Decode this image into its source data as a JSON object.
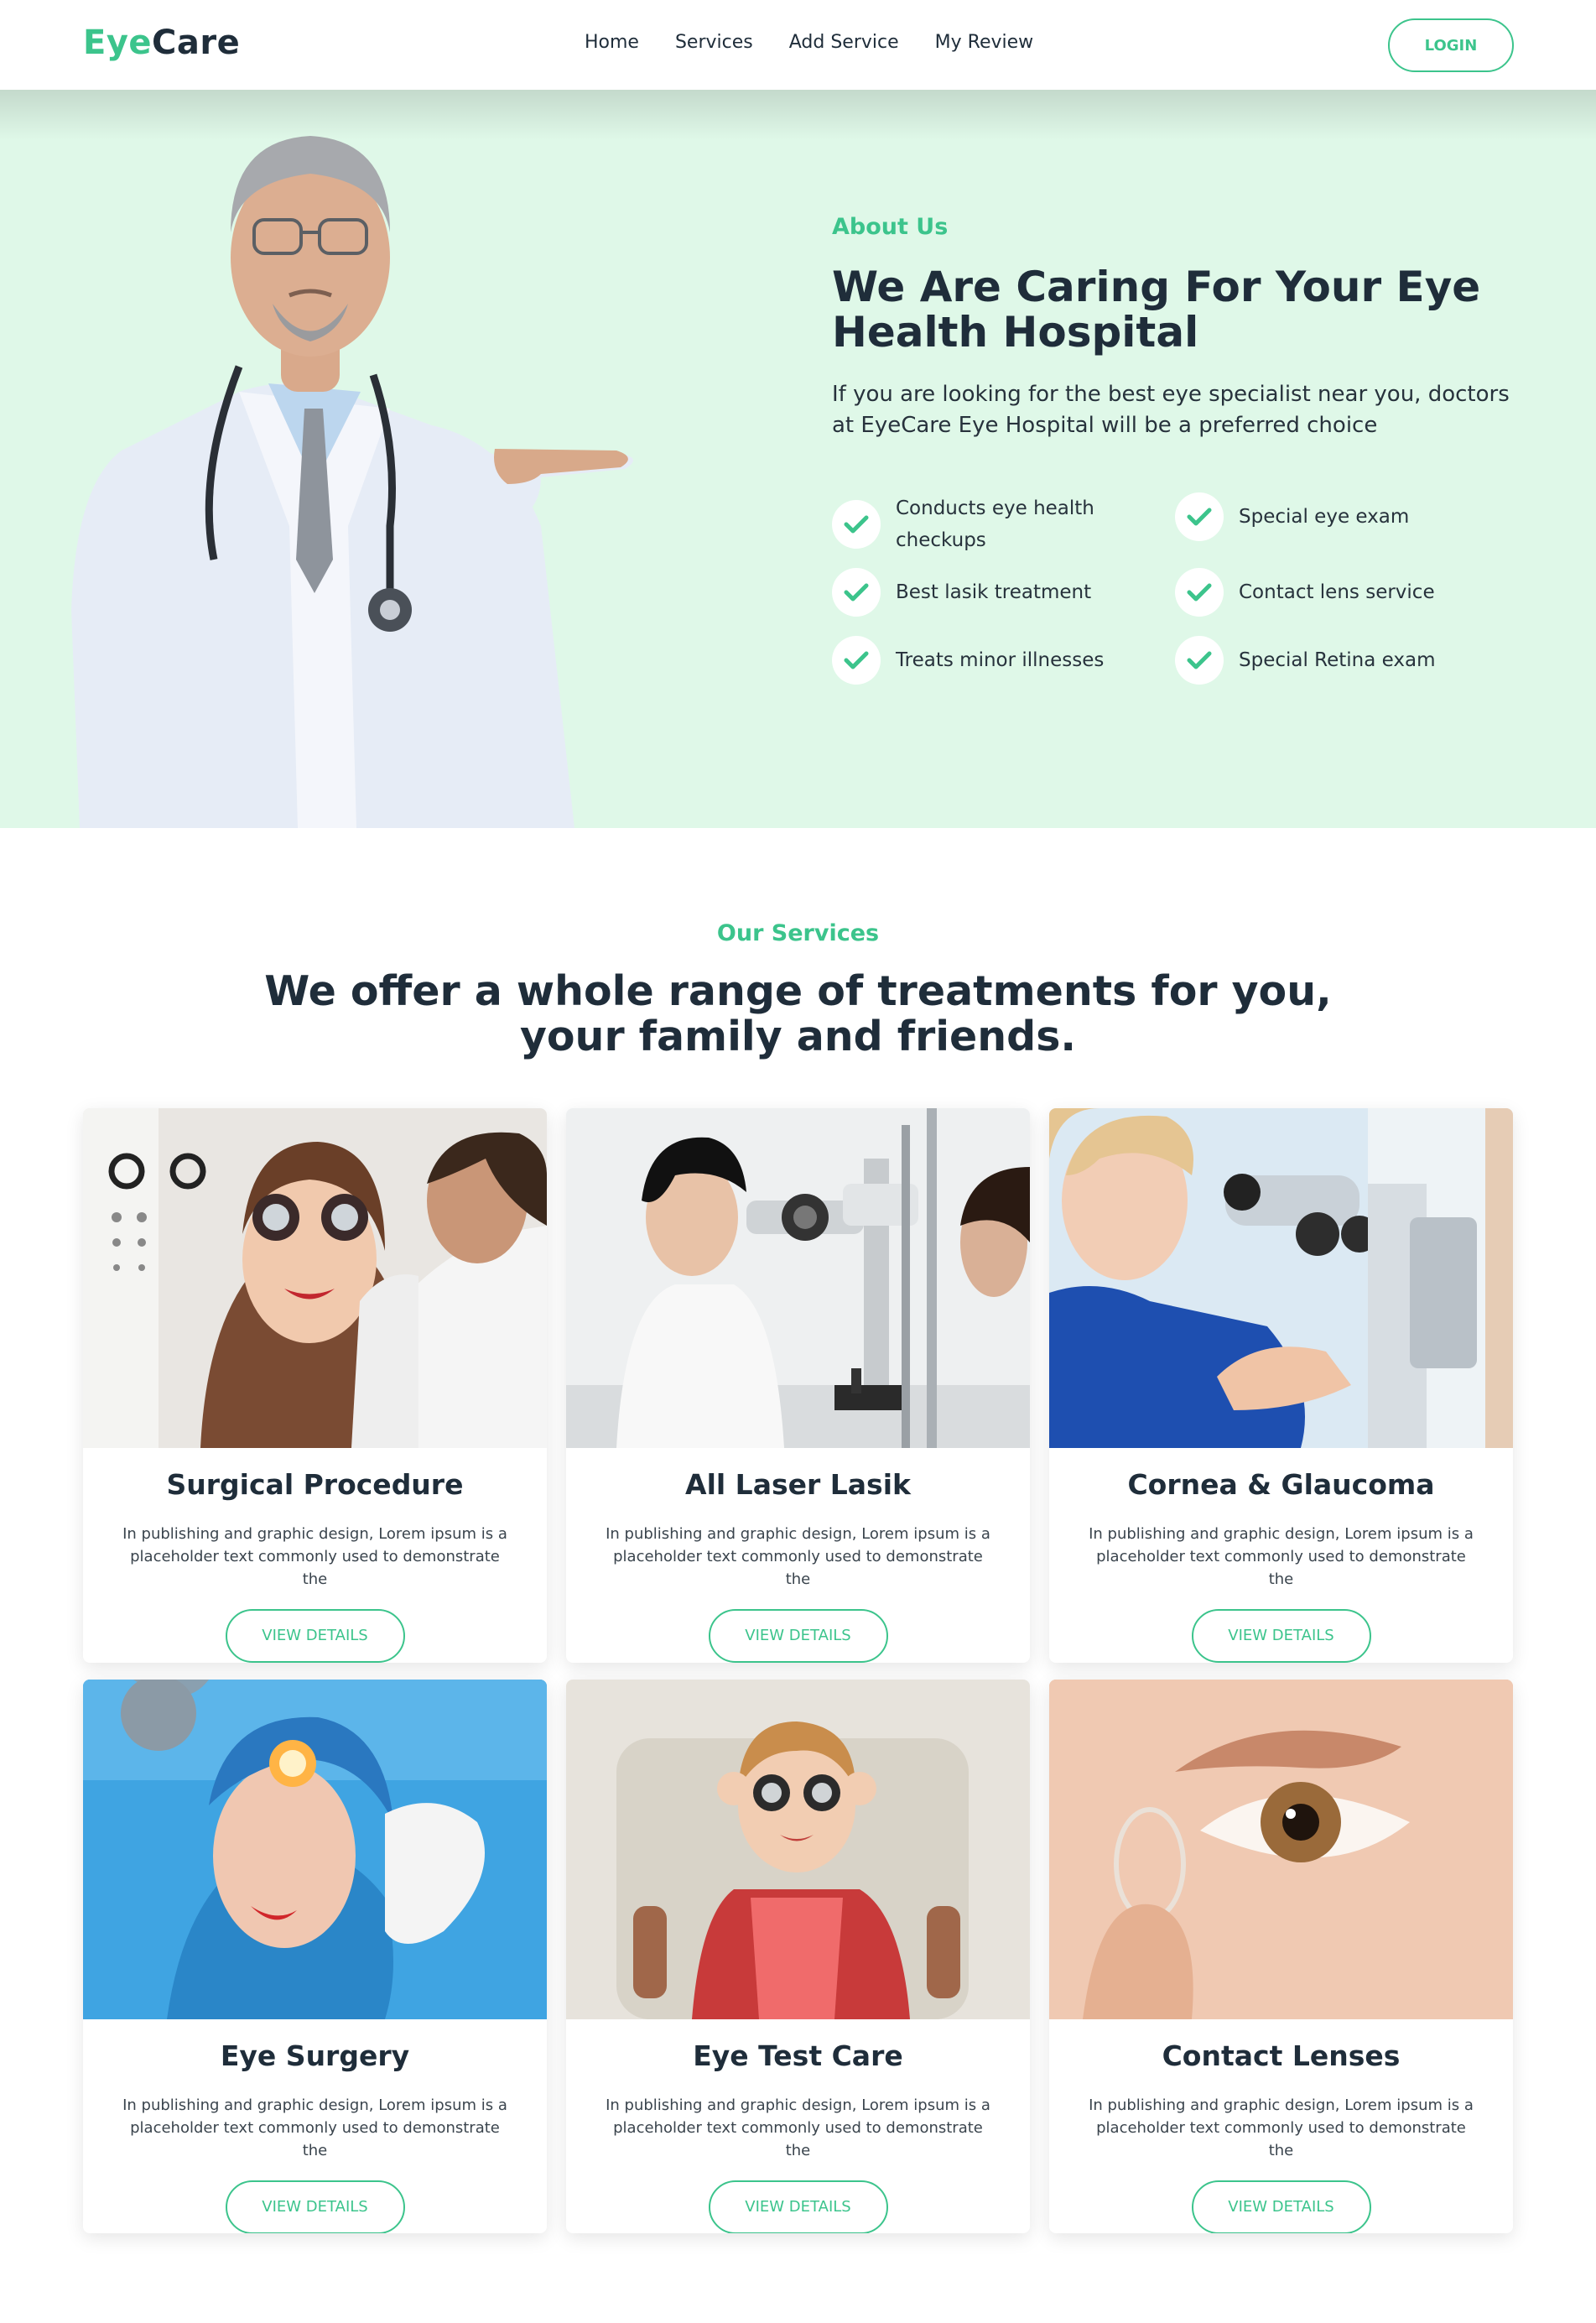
{
  "navbar": {
    "logo_part1": "Eye",
    "logo_part2": "Care",
    "links": [
      "Home",
      "Services",
      "Add Service",
      "My Review"
    ],
    "login_label": "LOGIN"
  },
  "about": {
    "label": "About Us",
    "title": "We Are Caring For Your Eye Health Hospital",
    "description": "If you are looking for the best eye specialist near you, doctors at EyeCare Eye Hospital will be a preferred choice",
    "features": [
      "Conducts eye health checkups",
      "Special eye exam",
      "Best lasik treatment",
      "Contact lens service",
      "Treats minor illnesses",
      "Special Retina exam"
    ]
  },
  "services": {
    "label": "Our Services",
    "title": "We offer a whole range of treatments for you, your family and friends.",
    "cards": [
      {
        "title": "Surgical Procedure",
        "description": "In publishing and graphic design, Lorem ipsum is a placeholder text commonly used to demonstrate the",
        "button": "VIEW DETAILS"
      },
      {
        "title": "All Laser Lasik",
        "description": "In publishing and graphic design, Lorem ipsum is a placeholder text commonly used to demonstrate the",
        "button": "VIEW DETAILS"
      },
      {
        "title": "Cornea & Glaucoma",
        "description": "In publishing and graphic design, Lorem ipsum is a placeholder text commonly used to demonstrate the",
        "button": "VIEW DETAILS"
      },
      {
        "title": "Eye Surgery",
        "description": "In publishing and graphic design, Lorem ipsum is a placeholder text commonly used to demonstrate the",
        "button": "VIEW DETAILS"
      },
      {
        "title": "Eye Test Care",
        "description": "In publishing and graphic design, Lorem ipsum is a placeholder text commonly used to demonstrate the",
        "button": "VIEW DETAILS"
      },
      {
        "title": "Contact Lenses",
        "description": "In publishing and graphic design, Lorem ipsum is a placeholder text commonly used to demonstrate the",
        "button": "VIEW DETAILS"
      }
    ]
  },
  "colors": {
    "accent": "#3cc48c",
    "hero_bg": "#dff8e8",
    "text_dark": "#1f2d3a"
  }
}
